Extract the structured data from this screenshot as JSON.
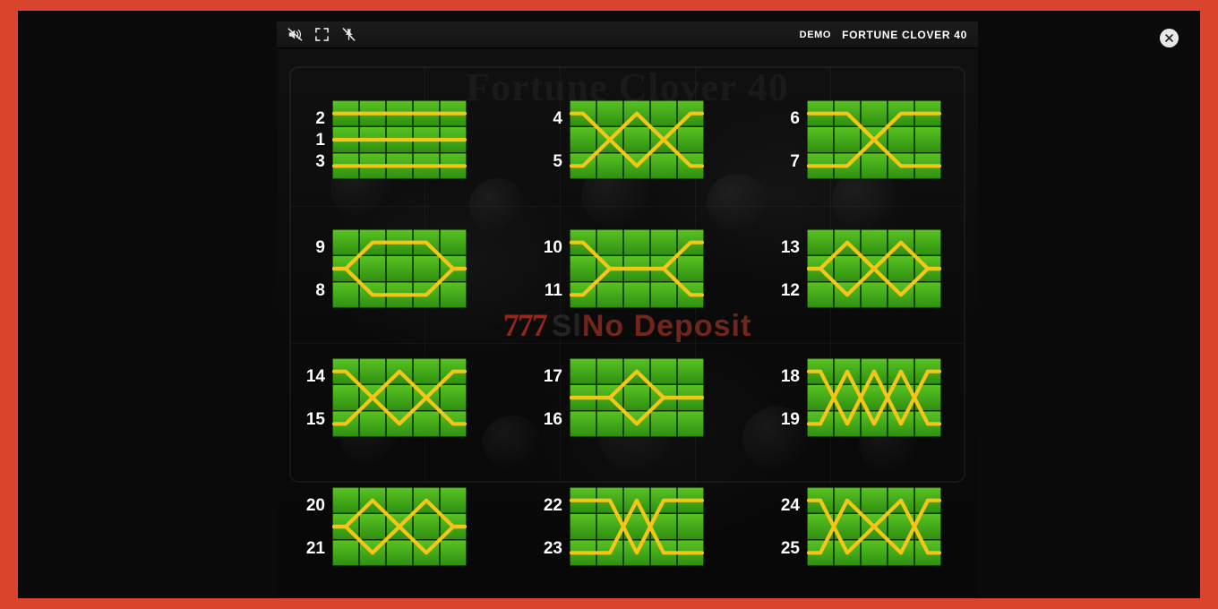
{
  "window": {
    "game_title": "FORTUNE CLOVER 40",
    "demo_label": "DEMO",
    "background_title": "Fortune Clover 40",
    "watermark_prefix": "Sl",
    "watermark_suffix": "No Deposit",
    "watermark_seven": "777"
  },
  "toolbar": {
    "buttons": [
      {
        "name": "mute-icon",
        "label": "Mute"
      },
      {
        "name": "fullscreen-icon",
        "label": "Fullscreen"
      },
      {
        "name": "pin-off-icon",
        "label": "Unpin"
      }
    ]
  },
  "close_button": {
    "label": "Close"
  },
  "colors": {
    "accent_red": "#d9452c",
    "payline_yellow": "#f5c518",
    "reel_green_light": "#58c322",
    "reel_green_dark": "#2f8f10",
    "text_white": "#ffffff"
  },
  "grid": {
    "columns": 5,
    "rows": 3
  },
  "paylines": [
    {
      "numbers": [
        {
          "id": "2",
          "pos": "top"
        },
        {
          "id": "1",
          "pos": "mid"
        },
        {
          "id": "3",
          "pos": "bottom"
        }
      ],
      "lines": [
        [
          0,
          0,
          0,
          0,
          0
        ],
        [
          1,
          1,
          1,
          1,
          1
        ],
        [
          2,
          2,
          2,
          2,
          2
        ]
      ]
    },
    {
      "numbers": [
        {
          "id": "4",
          "pos": "top"
        },
        {
          "id": "5",
          "pos": "bottom"
        }
      ],
      "lines": [
        [
          0,
          1,
          2,
          1,
          0
        ],
        [
          2,
          1,
          0,
          1,
          2
        ]
      ]
    },
    {
      "numbers": [
        {
          "id": "6",
          "pos": "top"
        },
        {
          "id": "7",
          "pos": "bottom"
        }
      ],
      "lines": [
        [
          0,
          0,
          1,
          2,
          2
        ],
        [
          2,
          2,
          1,
          0,
          0
        ]
      ]
    },
    {
      "numbers": [
        {
          "id": "9",
          "pos": "top"
        },
        {
          "id": "8",
          "pos": "bottom"
        }
      ],
      "lines": [
        [
          1,
          0,
          0,
          0,
          1
        ],
        [
          1,
          2,
          2,
          2,
          1
        ]
      ]
    },
    {
      "numbers": [
        {
          "id": "10",
          "pos": "top"
        },
        {
          "id": "11",
          "pos": "bottom"
        }
      ],
      "lines": [
        [
          0,
          1,
          1,
          1,
          0
        ],
        [
          2,
          1,
          1,
          1,
          2
        ]
      ]
    },
    {
      "numbers": [
        {
          "id": "13",
          "pos": "top"
        },
        {
          "id": "12",
          "pos": "bottom"
        }
      ],
      "lines": [
        [
          1,
          0,
          1,
          0,
          1
        ],
        [
          1,
          2,
          1,
          2,
          1
        ]
      ]
    },
    {
      "numbers": [
        {
          "id": "14",
          "pos": "top"
        },
        {
          "id": "15",
          "pos": "bottom"
        }
      ],
      "lines": [
        [
          0,
          1,
          0,
          1,
          0
        ],
        [
          2,
          1,
          2,
          1,
          2
        ]
      ]
    },
    {
      "numbers": [
        {
          "id": "17",
          "pos": "top"
        },
        {
          "id": "16",
          "pos": "bottom"
        }
      ],
      "lines": [
        [
          1,
          1,
          0,
          1,
          1
        ],
        [
          1,
          1,
          2,
          1,
          1
        ]
      ]
    },
    {
      "numbers": [
        {
          "id": "18",
          "pos": "top"
        },
        {
          "id": "19",
          "pos": "bottom"
        }
      ],
      "lines": [
        [
          0,
          2,
          0,
          2,
          0
        ],
        [
          2,
          0,
          2,
          0,
          2
        ]
      ]
    },
    {
      "numbers": [
        {
          "id": "20",
          "pos": "top"
        },
        {
          "id": "21",
          "pos": "bottom"
        }
      ],
      "lines": [
        [
          1,
          0,
          1,
          0,
          1
        ],
        [
          1,
          2,
          1,
          2,
          1
        ]
      ]
    },
    {
      "numbers": [
        {
          "id": "22",
          "pos": "top"
        },
        {
          "id": "23",
          "pos": "bottom"
        }
      ],
      "lines": [
        [
          0,
          0,
          2,
          0,
          0
        ],
        [
          2,
          2,
          0,
          2,
          2
        ]
      ]
    },
    {
      "numbers": [
        {
          "id": "24",
          "pos": "top"
        },
        {
          "id": "25",
          "pos": "bottom"
        }
      ],
      "lines": [
        [
          0,
          2,
          1,
          0,
          2
        ],
        [
          2,
          0,
          1,
          2,
          0
        ]
      ]
    }
  ]
}
